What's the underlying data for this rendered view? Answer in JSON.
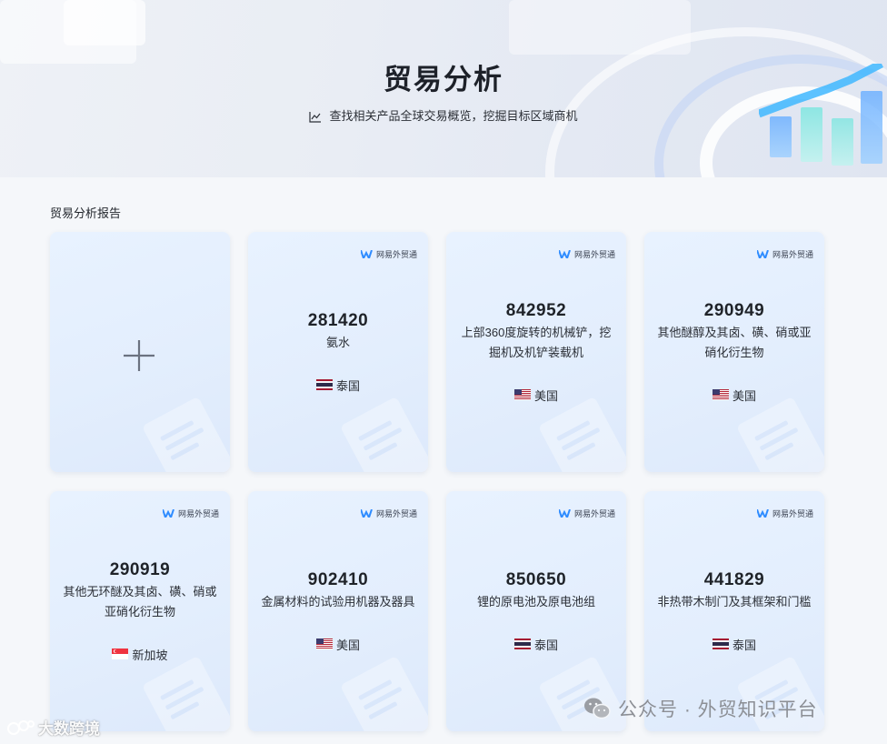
{
  "hero": {
    "title": "贸易分析",
    "subtitle": "查找相关产品全球交易概览，挖掘目标区域商机",
    "subtitle_icon": "line-chart-icon"
  },
  "section": {
    "title": "贸易分析报告"
  },
  "brand_label": "网易外贸通",
  "cards": [
    {
      "code": "281420",
      "name": "氨水",
      "country": "泰国",
      "flag": "thailand"
    },
    {
      "code": "842952",
      "name": "上部360度旋转的机械铲，挖掘机及机铲装载机",
      "country": "美国",
      "flag": "usa"
    },
    {
      "code": "290949",
      "name": "其他醚醇及其卤、磺、硝或亚硝化衍生物",
      "country": "美国",
      "flag": "usa"
    },
    {
      "code": "290919",
      "name": "其他无环醚及其卤、磺、硝或亚硝化衍生物",
      "country": "新加坡",
      "flag": "singapore"
    },
    {
      "code": "902410",
      "name": "金属材料的试验用机器及器具",
      "country": "美国",
      "flag": "usa"
    },
    {
      "code": "850650",
      "name": "锂的原电池及原电池组",
      "country": "泰国",
      "flag": "thailand"
    },
    {
      "code": "441829",
      "name": "非热带木制门及其框架和门槛",
      "country": "泰国",
      "flag": "thailand"
    }
  ],
  "watermarks": {
    "left": "大数跨境",
    "right": "公众号 · 外贸知识平台"
  },
  "colors": {
    "accent": "#2f8cff",
    "card_bg": "#e6f0fe",
    "page_bg": "#f5f7fa"
  }
}
